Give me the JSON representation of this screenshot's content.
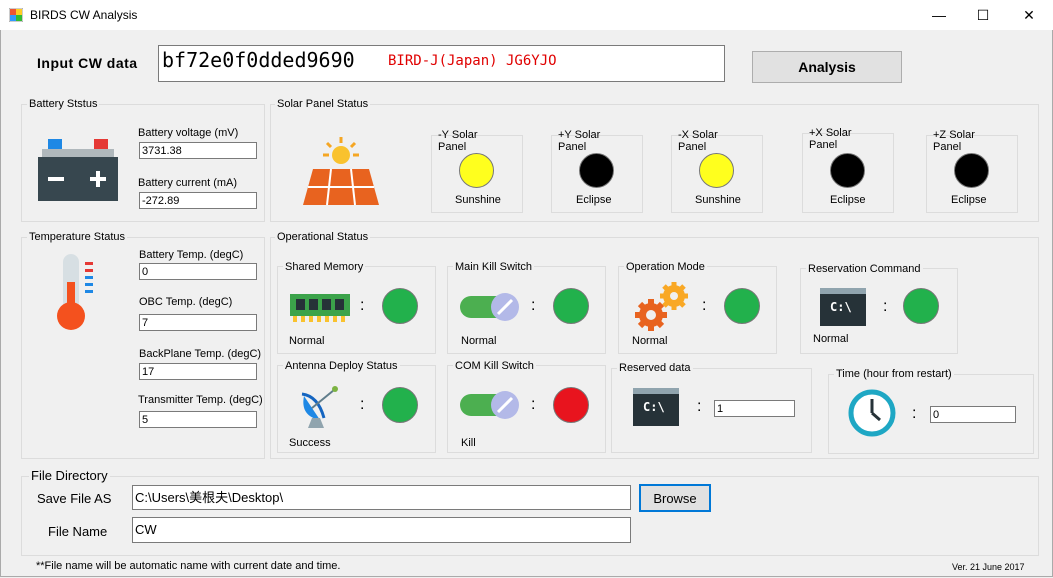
{
  "window": {
    "title": "BIRDS CW Analysis",
    "min": "—",
    "max": "☐",
    "close": "✕"
  },
  "input": {
    "label": "Input CW data",
    "value": "bf72e0f0dded9690",
    "satellite": "BIRD-J(Japan) JG6YJO"
  },
  "analysis_button": "Analysis",
  "battery": {
    "title": "Battery Ststus",
    "voltage_label": "Battery voltage (mV)",
    "voltage_value": "3731.38",
    "current_label": "Battery current (mA)",
    "current_value": "-272.89"
  },
  "solar": {
    "title": "Solar Panel Status",
    "panels": [
      {
        "name": "-Y Solar Panel",
        "status": "Sunshine",
        "color": "#ffff1e"
      },
      {
        "name": "+Y Solar Panel",
        "status": "Eclipse",
        "color": "#000000"
      },
      {
        "name": "-X Solar Panel",
        "status": "Sunshine",
        "color": "#ffff1e"
      },
      {
        "name": "+X Solar Panel",
        "status": "Eclipse",
        "color": "#000000"
      },
      {
        "name": "+Z Solar Panel",
        "status": "Eclipse",
        "color": "#000000"
      }
    ]
  },
  "temperature": {
    "title": "Temperature Status",
    "battery_label": "Battery Temp. (degC)",
    "battery_value": "0",
    "obc_label": "OBC Temp. (degC)",
    "obc_value": "7",
    "backplane_label": "BackPlane Temp. (degC)",
    "backplane_value": "17",
    "transmitter_label": "Transmitter Temp. (degC)",
    "transmitter_value": "5"
  },
  "operational": {
    "title": "Operational Status",
    "shared_memory": {
      "title": "Shared Memory",
      "status": "Normal",
      "color": "#22b14c"
    },
    "main_kill": {
      "title": "Main Kill Switch",
      "status": "Normal",
      "color": "#22b14c"
    },
    "operation_mode": {
      "title": "Operation Mode",
      "status": "Normal",
      "color": "#22b14c"
    },
    "reservation": {
      "title": "Reservation Command",
      "status": "Normal",
      "color": "#22b14c"
    },
    "antenna": {
      "title": "Antenna Deploy Status",
      "status": "Success",
      "color": "#22b14c"
    },
    "com_kill": {
      "title": "COM Kill Switch",
      "status": "Kill",
      "color": "#e8141e"
    },
    "reserved": {
      "title": "Reserved data",
      "value": "1"
    },
    "time": {
      "title": "Time (hour from restart)",
      "value": "0"
    },
    "colon": ":"
  },
  "file": {
    "title": "File Directory",
    "save_label": "Save File AS",
    "save_value": "C:\\Users\\美根夫\\Desktop\\",
    "browse": "Browse",
    "name_label": "File Name",
    "name_value": "CW",
    "note": "**File name will be automatic name with current date and time.",
    "version": "Ver. 21 June 2017"
  },
  "icons": {
    "battery": "battery-icon",
    "solar": "solar-panel-icon",
    "thermometer": "thermometer-icon",
    "memory": "memory-chip-icon",
    "toggle": "toggle-switch-icon",
    "gears": "gears-icon",
    "terminal": "terminal-icon",
    "satellite": "satellite-dish-icon",
    "clock": "clock-icon"
  },
  "terminal_text": "C:\\"
}
